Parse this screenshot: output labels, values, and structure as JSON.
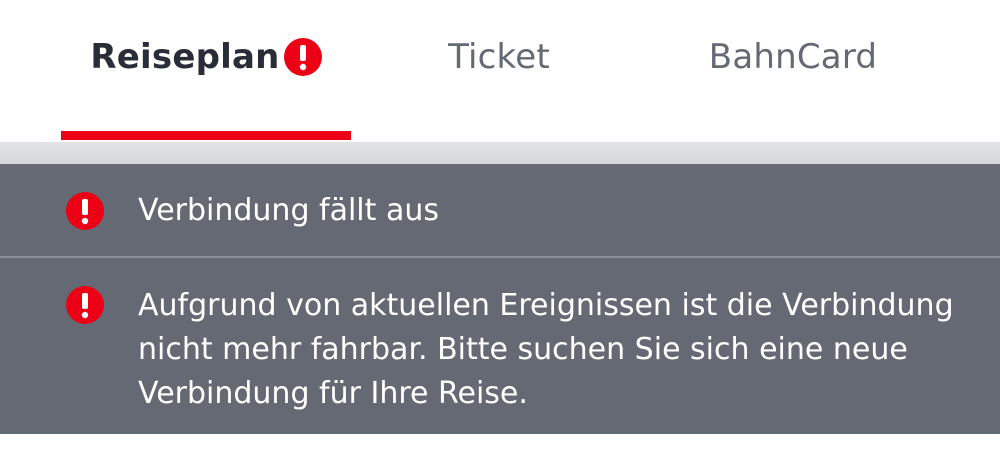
{
  "tabs": [
    {
      "label": "Reiseplan",
      "active": true,
      "alert": true
    },
    {
      "label": "Ticket",
      "active": false,
      "alert": false
    },
    {
      "label": "BahnCard",
      "active": false,
      "alert": false
    }
  ],
  "messages": [
    {
      "icon": "exclamation-icon",
      "text": "Verbindung fällt aus"
    },
    {
      "icon": "exclamation-icon",
      "text": "Aufgrund von aktuellen Ereignissen ist die Verbindung nicht mehr fahrbar. Bitte suchen Sie sich eine neue Verbindung für Ihre Reise."
    }
  ],
  "colors": {
    "accent": "#ec0016",
    "panel": "#646973",
    "active_text": "#282d37",
    "inactive_text": "#646973"
  }
}
